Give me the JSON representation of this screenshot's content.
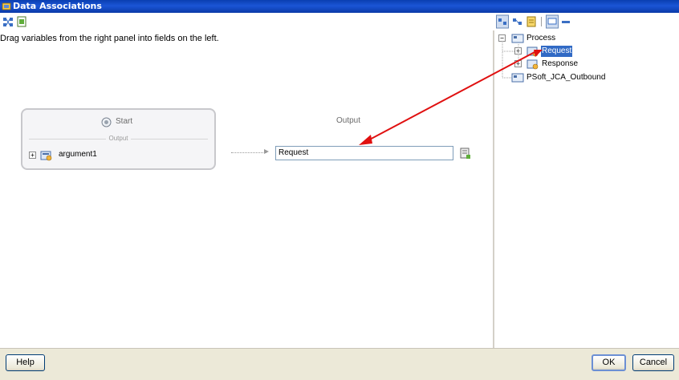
{
  "window": {
    "title": "Data Associations"
  },
  "instructions": "Drag variables from the right panel into fields on the left.",
  "start_node": {
    "title": "Start",
    "section_label": "Output",
    "argument_label": "argument1"
  },
  "output": {
    "label": "Output",
    "value": "Request"
  },
  "tree": {
    "root": "Process",
    "children": [
      "Request",
      "Response"
    ],
    "sibling": "PSoft_JCA_Outbound",
    "selected": "Request"
  },
  "buttons": {
    "help": "Help",
    "ok": "OK",
    "cancel": "Cancel"
  },
  "icons": {
    "title": "window-app-icon",
    "left_toolbar": [
      "map-icon",
      "page-icon"
    ],
    "right_toolbar": [
      "variable-view-icon",
      "type-view-icon",
      "list-icon",
      "separator",
      "panel-icon",
      "collapse-icon"
    ]
  },
  "annotation": {
    "color": "#e01010"
  },
  "colors": {
    "titlebar": "#0a3fb0",
    "selection": "#316ac5",
    "field_border": "#7f9db9"
  }
}
